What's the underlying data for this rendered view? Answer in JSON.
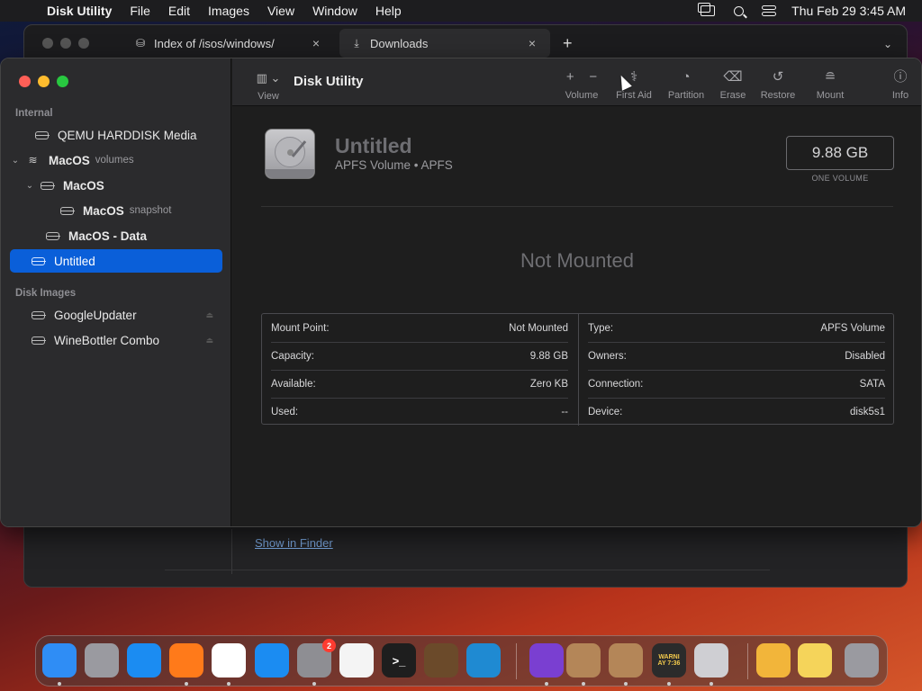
{
  "menubar": {
    "apple": "",
    "app_name": "Disk Utility",
    "menus": [
      "File",
      "Edit",
      "Images",
      "View",
      "Window",
      "Help"
    ],
    "datetime": "Thu Feb 29  3:45 AM",
    "status_icons": [
      "screen-mirroring-icon",
      "search-icon",
      "control-center-icon"
    ]
  },
  "browser": {
    "tabs": [
      {
        "label": "Index of /isos/windows/",
        "icon": "site-favicon-icon",
        "close": "×"
      },
      {
        "label": "Downloads",
        "icon": "download-icon",
        "close": "×"
      }
    ],
    "new_tab": "+",
    "tab_overflow": "⌄",
    "show_in_finder": "Show in Finder"
  },
  "disk_utility": {
    "sidebar": {
      "internal_header": "Internal",
      "disk_images_header": "Disk Images",
      "items": [
        {
          "label": "QEMU HARDDISK Media",
          "sub": ""
        },
        {
          "label": "MacOS",
          "sub": "volumes"
        },
        {
          "label": "MacOS",
          "sub": ""
        },
        {
          "label": "MacOS",
          "sub": "snapshot"
        },
        {
          "label": "MacOS - Data",
          "sub": ""
        },
        {
          "label": "Untitled",
          "sub": ""
        },
        {
          "label": "GoogleUpdater",
          "sub": ""
        },
        {
          "label": "WineBottler Combo",
          "sub": ""
        }
      ],
      "disclosure_expanded": "⌄"
    },
    "toolbar": {
      "view_label": "View",
      "title": "Disk Utility",
      "plus": "+",
      "minus": "−",
      "volume_label": "Volume",
      "first_aid_label": "First Aid",
      "partition_label": "Partition",
      "erase_label": "Erase",
      "restore_label": "Restore",
      "mount_label": "Mount",
      "info_label": "Info"
    },
    "volume": {
      "name": "Untitled",
      "subtitle": "APFS Volume • APFS",
      "size": "9.88 GB",
      "size_caption": "ONE VOLUME",
      "status": "Not Mounted"
    },
    "info": {
      "left": [
        {
          "label": "Mount Point:",
          "value": "Not Mounted"
        },
        {
          "label": "Capacity:",
          "value": "9.88 GB"
        },
        {
          "label": "Available:",
          "value": "Zero KB"
        },
        {
          "label": "Used:",
          "value": "--"
        }
      ],
      "right": [
        {
          "label": "Type:",
          "value": "APFS Volume"
        },
        {
          "label": "Owners:",
          "value": "Disabled"
        },
        {
          "label": "Connection:",
          "value": "SATA"
        },
        {
          "label": "Device:",
          "value": "disk5s1"
        }
      ]
    }
  },
  "dock": {
    "apps": [
      {
        "name": "finder-icon",
        "color": "#2f8df5",
        "running": true
      },
      {
        "name": "launchpad-icon",
        "color": "#9a9aa0",
        "running": false
      },
      {
        "name": "safari-icon",
        "color": "#1b8cf2",
        "running": false
      },
      {
        "name": "firefox-icon",
        "color": "#ff7a1a",
        "running": true
      },
      {
        "name": "chrome-icon",
        "color": "#ffffff",
        "running": true
      },
      {
        "name": "app-store-icon",
        "color": "#1b8cf2",
        "running": false
      },
      {
        "name": "system-preferences-icon",
        "color": "#8e8e93",
        "running": true,
        "badge": "2"
      },
      {
        "name": "textedit-icon",
        "color": "#f4f4f4",
        "running": false
      },
      {
        "name": "terminal-icon",
        "color": "#1e1e1e",
        "running": false,
        "glyph": ">_"
      },
      {
        "name": "instruments-icon",
        "color": "#6b4a2a",
        "running": false
      },
      {
        "name": "vscode-icon",
        "color": "#1f8ad2",
        "running": false
      },
      {
        "name": "affinity-icon",
        "color": "#7a3fd1",
        "running": true
      },
      {
        "name": "box-app-icon",
        "color": "#b48658",
        "running": true
      },
      {
        "name": "box-app-icon-2",
        "color": "#b48658",
        "running": true
      },
      {
        "name": "console-icon",
        "color": "#2b2b2b",
        "running": true,
        "glyph": "WARNI\nAY 7:36"
      },
      {
        "name": "disk-utility-icon",
        "color": "#cfcfd3",
        "running": true
      },
      {
        "name": "folder-icon",
        "color": "#f2b53a",
        "running": false
      },
      {
        "name": "archive-icon",
        "color": "#f5d45a",
        "running": false
      },
      {
        "name": "trash-icon",
        "color": "#9a9aa0",
        "running": false
      }
    ]
  }
}
